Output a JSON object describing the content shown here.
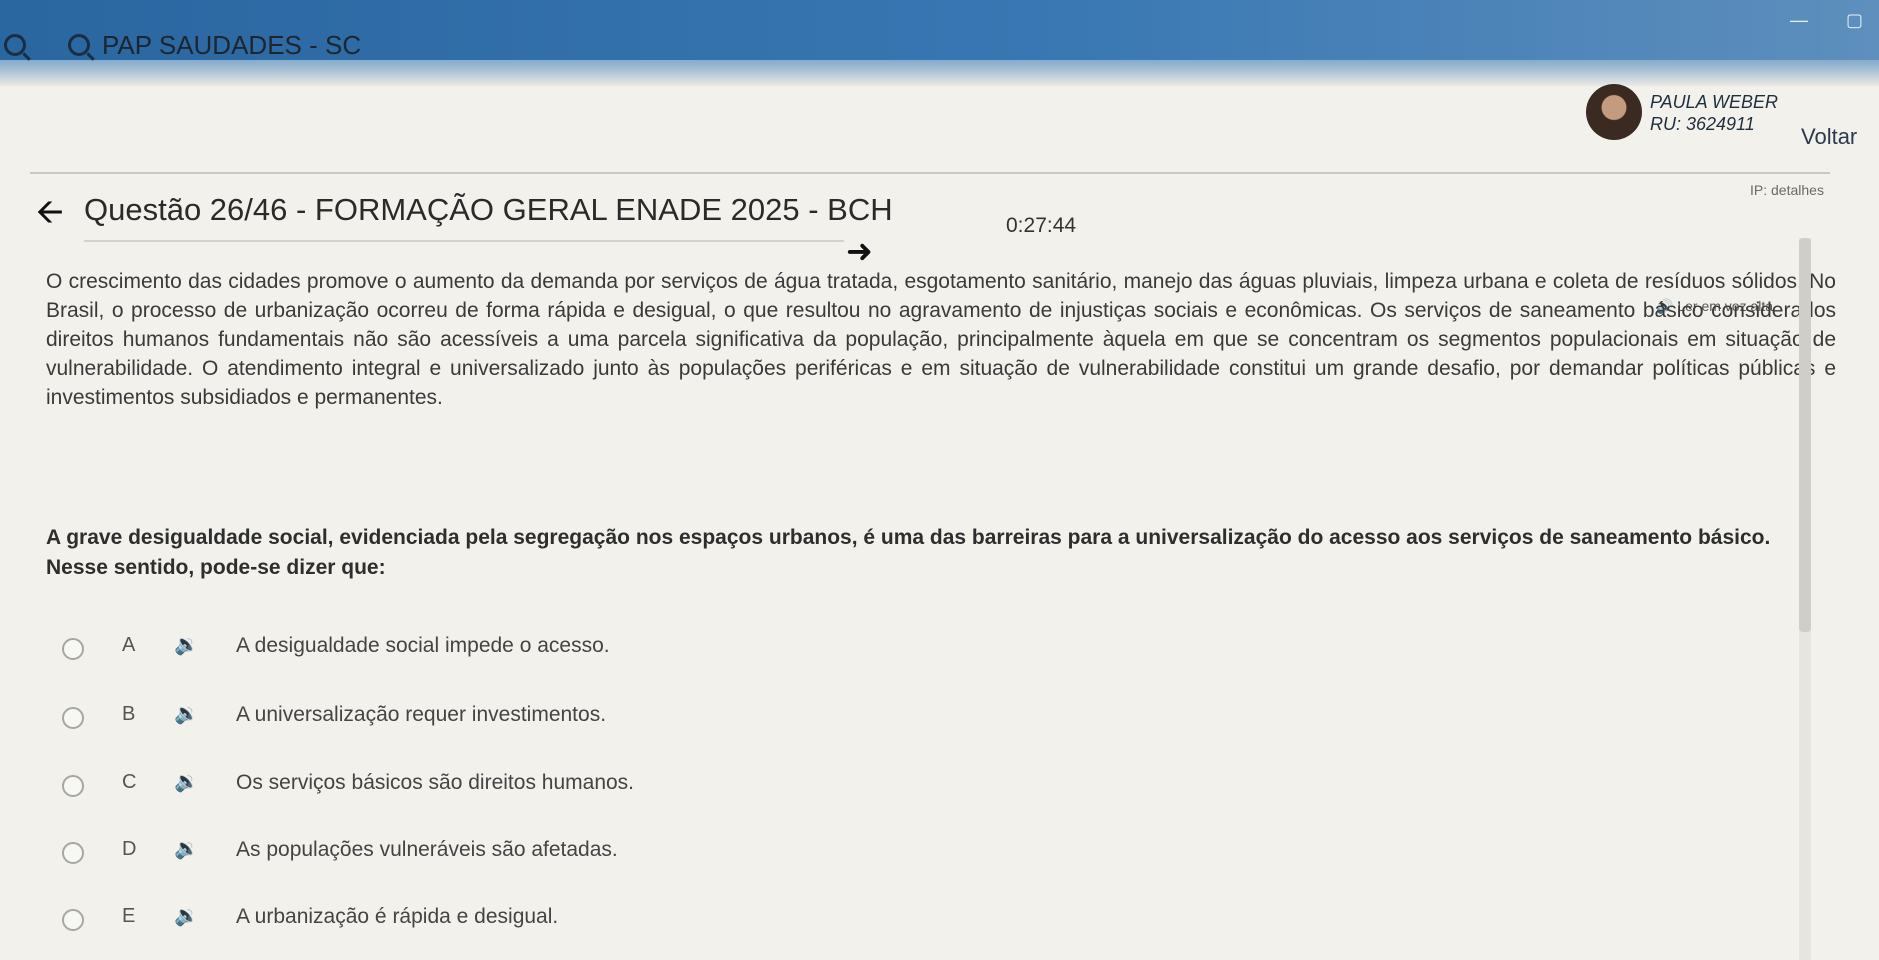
{
  "window": {
    "title": "PAP SAUDADES - SC",
    "icons": [
      "zoom-in-icon",
      "zoom-out-icon"
    ],
    "controls": [
      "—",
      "▢"
    ]
  },
  "user": {
    "name": "PAULA WEBER",
    "ru": "RU: 3624911",
    "back_label": "Voltar",
    "details_label": "IP: detalhes"
  },
  "question": {
    "title": "Questão 26/46 - FORMAÇÃO GERAL ENADE 2025 - BCH",
    "timer": "0:27:44",
    "read_aloud_label": "🔊 Ler em voz alta",
    "passage": "O crescimento das cidades promove o aumento da demanda por serviços de água tratada, esgotamento sanitário, manejo das águas pluviais, limpeza urbana e coleta de resíduos sólidos. No Brasil, o processo de urbanização ocorreu de forma rápida e desigual, o que resultou no agravamento de injustiças sociais e econômicas. Os serviços de saneamento básico considerados direitos humanos fundamentais não são acessíveis a uma parcela significativa da população, principalmente àquela em que se concentram os segmentos populacionais em situação de vulnerabilidade. O atendimento integral e universalizado junto às populações periféricas e em situação de vulnerabilidade constitui um grande desafio, por demandar políticas públicas e investimentos subsidiados e permanentes.",
    "prompt": "A grave desigualdade social, evidenciada pela segregação nos espaços urbanos, é uma das barreiras para a universalização do acesso aos serviços de saneamento básico. Nesse sentido, pode-se dizer que:"
  },
  "options": [
    {
      "letter": "A",
      "text": "A desigualdade social impede o acesso."
    },
    {
      "letter": "B",
      "text": "A universalização requer investimentos."
    },
    {
      "letter": "C",
      "text": "Os serviços básicos são direitos humanos."
    },
    {
      "letter": "D",
      "text": "As populações vulneráveis são afetadas."
    },
    {
      "letter": "E",
      "text": "A urbanização é rápida e desigual."
    }
  ],
  "colors": {
    "header": "#3877b3",
    "background": "#f2f1ec",
    "text": "#3a3a3a"
  }
}
